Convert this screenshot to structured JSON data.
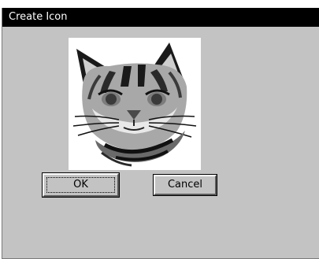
{
  "window": {
    "title": "Create Icon"
  },
  "icon_canvas": {
    "image": "cat-face-icon"
  },
  "buttons": {
    "ok_label": "OK",
    "cancel_label": "Cancel"
  },
  "colors": {
    "dialog_background": "#c3c3c3",
    "title_bar": "#000000",
    "title_text": "#ffffff",
    "canvas_background": "#ffffff"
  }
}
